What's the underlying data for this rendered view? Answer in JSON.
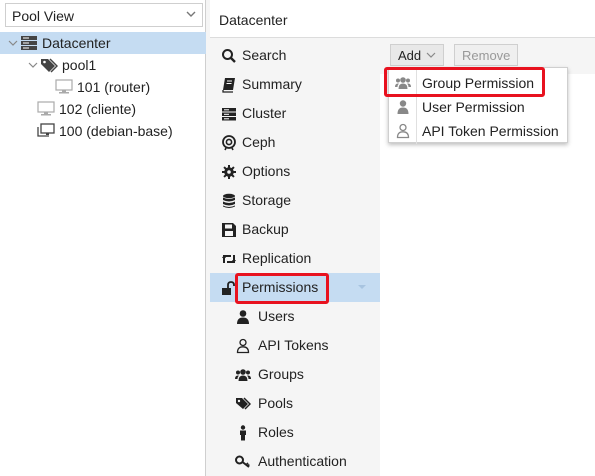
{
  "left": {
    "view_select": "Pool View",
    "tree": [
      {
        "label": "Datacenter",
        "icon": "server-stack-icon"
      },
      {
        "label": "pool1",
        "icon": "tags-icon"
      },
      {
        "label": "101 (router)",
        "icon": "monitor-icon"
      },
      {
        "label": "102 (cliente)",
        "icon": "monitor-icon"
      },
      {
        "label": "100 (debian-base)",
        "icon": "template-icon"
      }
    ]
  },
  "header": {
    "title": "Datacenter"
  },
  "nav": {
    "items": [
      {
        "label": "Search",
        "icon": "search-icon"
      },
      {
        "label": "Summary",
        "icon": "book-icon"
      },
      {
        "label": "Cluster",
        "icon": "server-icon"
      },
      {
        "label": "Ceph",
        "icon": "ceph-icon"
      },
      {
        "label": "Options",
        "icon": "gear-icon"
      },
      {
        "label": "Storage",
        "icon": "database-icon"
      },
      {
        "label": "Backup",
        "icon": "floppy-icon"
      },
      {
        "label": "Replication",
        "icon": "retweet-icon"
      },
      {
        "label": "Permissions",
        "icon": "unlock-icon"
      },
      {
        "label": "Users",
        "icon": "user-icon"
      },
      {
        "label": "API Tokens",
        "icon": "user-outline-icon"
      },
      {
        "label": "Groups",
        "icon": "users-icon"
      },
      {
        "label": "Pools",
        "icon": "tags-icon"
      },
      {
        "label": "Roles",
        "icon": "male-icon"
      },
      {
        "label": "Authentication",
        "icon": "key-icon"
      }
    ]
  },
  "toolbar": {
    "add_label": "Add",
    "remove_label": "Remove"
  },
  "dropdown": {
    "items": [
      {
        "label": "Group Permission",
        "icon": "users-icon"
      },
      {
        "label": "User Permission",
        "icon": "user-icon"
      },
      {
        "label": "API Token Permission",
        "icon": "user-outline-icon"
      }
    ]
  },
  "colors": {
    "selected": "#c5dcf2",
    "highlight": "#e8121f",
    "icon": "#222222"
  }
}
